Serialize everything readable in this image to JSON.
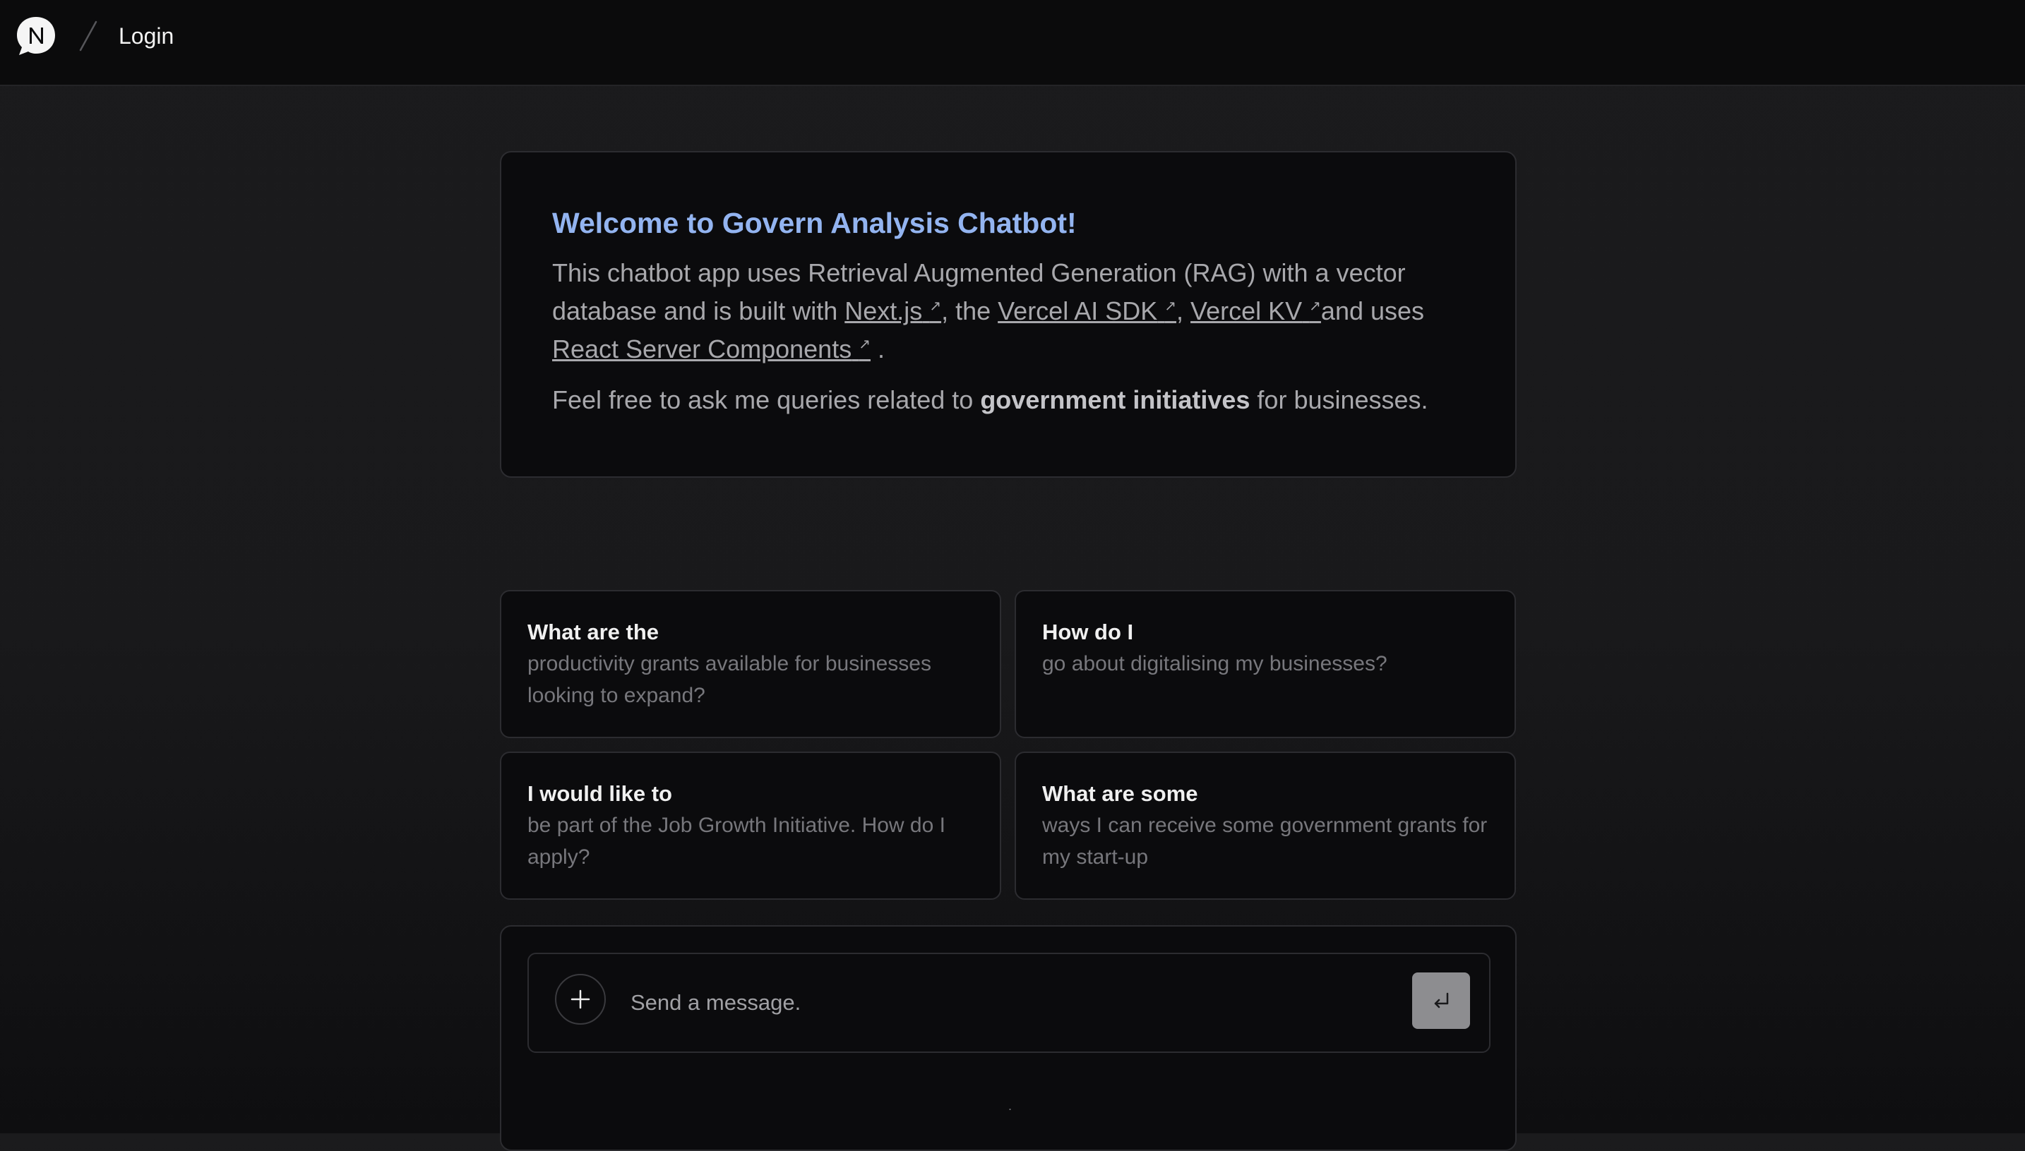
{
  "header": {
    "logo_icon": "chat-logo-icon",
    "separator_icon": "slash-separator-icon",
    "login_label": "Login"
  },
  "welcome": {
    "title": "Welcome to Govern Analysis Chatbot!",
    "intro_1": "This chatbot app uses Retrieval Augmented Generation (RAG) with a vector database and is built with ",
    "link_nextjs": "Next.js",
    "sep_1": ", the ",
    "link_vercel_ai_sdk": "Vercel AI SDK",
    "sep_2": ", ",
    "link_vercel_kv": "Vercel KV",
    "sep_3": "and uses ",
    "link_rsc": "React Server Components",
    "end": ".",
    "external_icon": "↗",
    "ask_prefix": "Feel free to ask me queries related to ",
    "ask_bold": "government initiatives",
    "ask_suffix": " for businesses."
  },
  "suggestions": [
    {
      "heading": "What are the",
      "message": "productivity grants available for businesses looking to expand?"
    },
    {
      "heading": "How do I",
      "message": "go about digitalising my businesses?"
    },
    {
      "heading": "I would like to",
      "message": "be part of the Job Growth Initiative. How do I apply?"
    },
    {
      "heading": "What are some",
      "message": "ways I can receive some government grants for my start-up"
    }
  ],
  "composer": {
    "placeholder": "Send a message.",
    "attach_icon": "plus-icon",
    "send_icon": "enter-return-icon",
    "footer_text": "."
  },
  "colors": {
    "accent_title": "#93b4f0",
    "card_bg": "#0b0b0d",
    "send_button_bg": "#8d8d90"
  }
}
